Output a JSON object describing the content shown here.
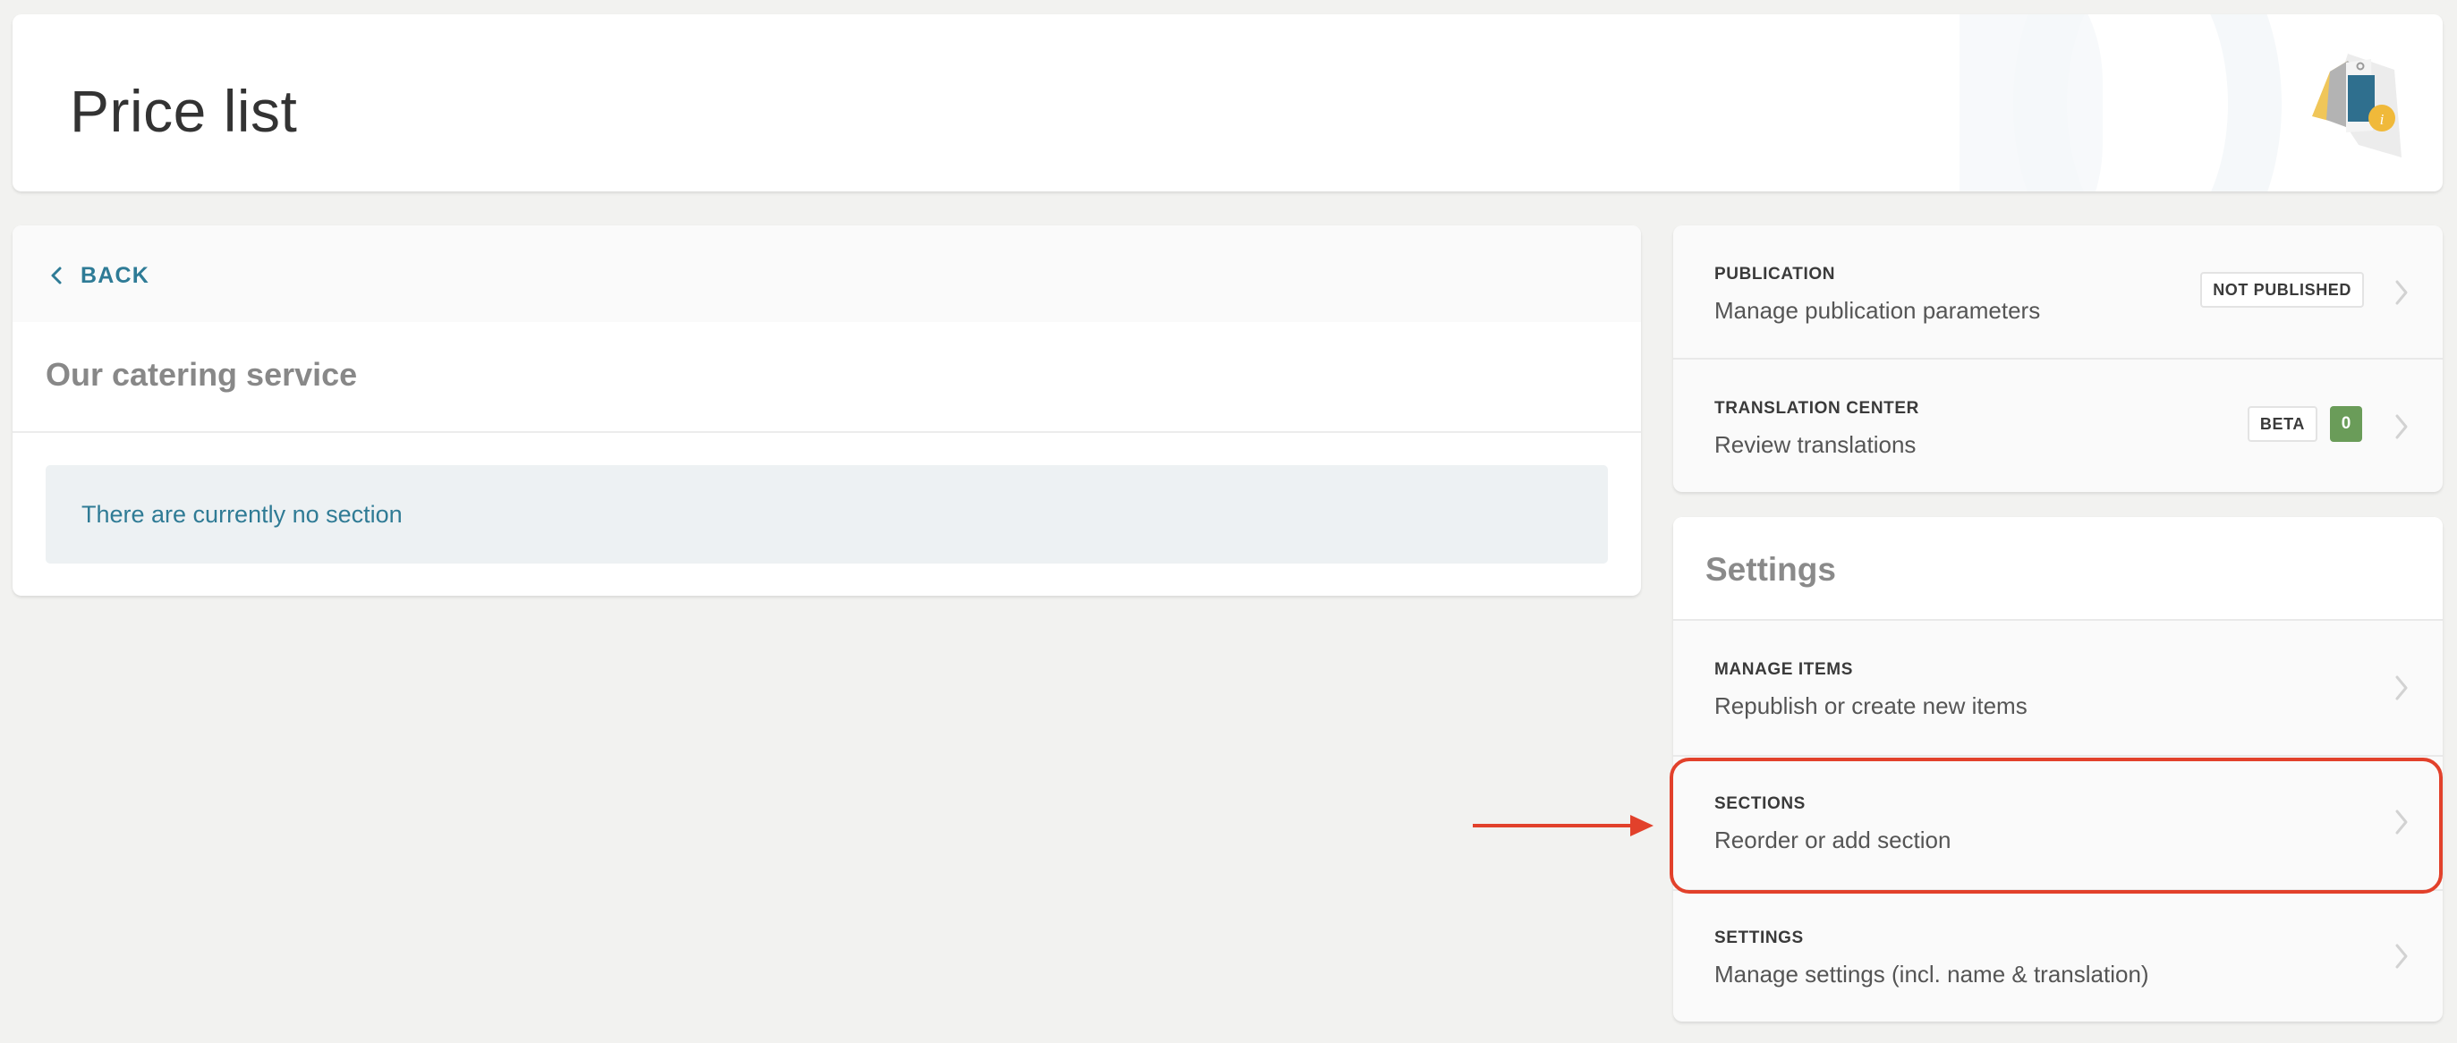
{
  "header": {
    "title": "Price list",
    "logo_icon": "price-tag-info-icon"
  },
  "left": {
    "back_label": "BACK",
    "back_icon": "chevron-left-icon",
    "service_title": "Our catering service",
    "empty_message": "There are currently no section"
  },
  "publication": {
    "title": "PUBLICATION",
    "description": "Manage publication parameters",
    "status_badge": "NOT PUBLISHED"
  },
  "translation": {
    "title": "TRANSLATION CENTER",
    "description": "Review translations",
    "beta_badge": "BETA",
    "count": "0"
  },
  "settings_card": {
    "heading": "Settings",
    "items": [
      {
        "title": "MANAGE ITEMS",
        "description": "Republish or create new items"
      },
      {
        "title": "SECTIONS",
        "description": "Reorder or add section"
      },
      {
        "title": "SETTINGS",
        "description": "Manage settings (incl. name & translation)"
      }
    ]
  },
  "colors": {
    "accent": "#2e7b96",
    "highlight": "#e2412b",
    "count_badge": "#6a9c59",
    "background": "#f2f2f0"
  }
}
